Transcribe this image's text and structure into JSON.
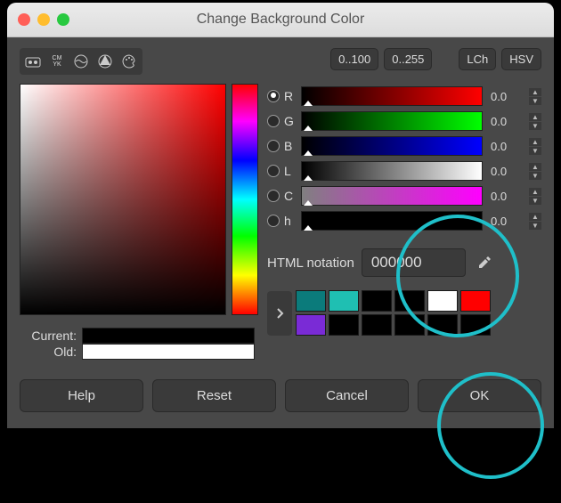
{
  "window": {
    "title": "Change Background Color"
  },
  "modes": [
    "gimp",
    "cmyk",
    "wheel",
    "triangle",
    "palette"
  ],
  "ranges": {
    "r1": "0..100",
    "r2": "0..255",
    "lch": "LCh",
    "hsv": "HSV"
  },
  "channels": [
    {
      "key": "R",
      "value": "0.0",
      "selected": true,
      "gradient": "linear-gradient(to right,#000,#ff0000)"
    },
    {
      "key": "G",
      "value": "0.0",
      "selected": false,
      "gradient": "linear-gradient(to right,#000,#00ff00)"
    },
    {
      "key": "B",
      "value": "0.0",
      "selected": false,
      "gradient": "linear-gradient(to right,#000,#0000ff)"
    },
    {
      "key": "L",
      "value": "0.0",
      "selected": false,
      "gradient": "linear-gradient(to right,#000,#ffffff)"
    },
    {
      "key": "C",
      "value": "0.0",
      "selected": false,
      "gradient": "linear-gradient(to right,#808080,#ff00ff)"
    },
    {
      "key": "h",
      "value": "0.0",
      "selected": false,
      "gradient": "#000"
    }
  ],
  "html_notation": {
    "label": "HTML notation",
    "value": "000000"
  },
  "current_old": {
    "current_label": "Current:",
    "old_label": "Old:",
    "current_color": "#000000",
    "old_color": "#ffffff"
  },
  "palette": [
    "#0b7b7b",
    "#1fbfb2",
    "#000000",
    "#000000",
    "#ffffff",
    "#ff0000",
    "#7a2bd6",
    "#000000",
    "#000000",
    "#000000",
    "#000000",
    "#000000"
  ],
  "buttons": {
    "help": "Help",
    "reset": "Reset",
    "cancel": "Cancel",
    "ok": "OK"
  }
}
